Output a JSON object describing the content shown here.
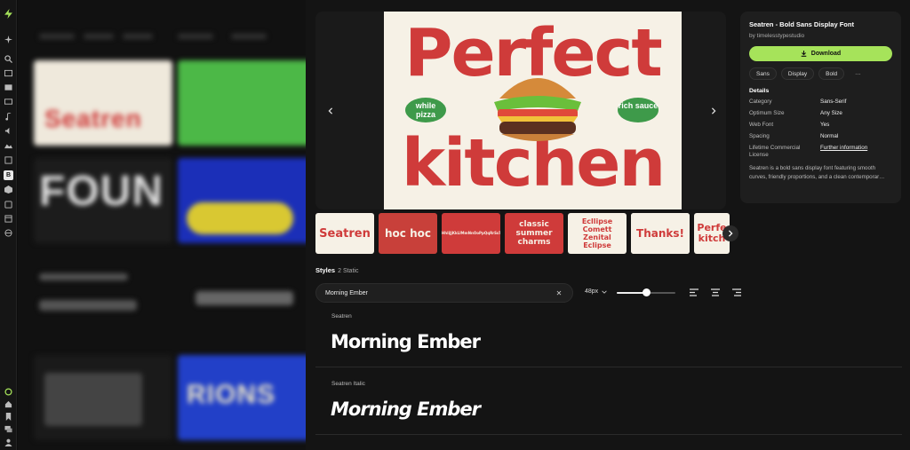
{
  "font": {
    "title": "Seatren - Bold Sans Display Font",
    "author": "by timelesstypestudio",
    "download_label": "Download",
    "tags": [
      "Sans",
      "Display",
      "Bold",
      "···"
    ],
    "details_heading": "Details",
    "details": [
      {
        "key": "Category",
        "value": "Sans-Serif"
      },
      {
        "key": "Optimum Size",
        "value": "Any Size"
      },
      {
        "key": "Web Font",
        "value": "Yes"
      },
      {
        "key": "Spacing",
        "value": "Normal"
      },
      {
        "key": "Lifetime Commercial License",
        "value": "Further information"
      }
    ],
    "description": "Seatren is a bold sans display font featuring smooth curves, friendly proportions, and a clean contemporar…"
  },
  "preview": {
    "line1": "Perfect",
    "line2": "kitchen",
    "pill_left": "while pizza",
    "pill_right": "rich sauce"
  },
  "thumbnails": [
    {
      "text": "Seatren",
      "bg": "#f6f1e6",
      "fg": "#cf3b3a"
    },
    {
      "text": "hoc hoc",
      "bg": "#c8403a",
      "fg": "#f6f1e6"
    },
    {
      "text": "AaBbCcDdEeFfGgHhIiJjKkLlMmNnOoPpQqRrSsTtUuVvWwXxYyZz",
      "bg": "#cf3b3a",
      "fg": "#f6f1e6"
    },
    {
      "text": "classic summer charms",
      "bg": "#cf3b3a",
      "fg": "#f6f1e6"
    },
    {
      "text": "Ecllipse Comett Zenital Eclipse",
      "bg": "#f6f1e6",
      "fg": "#cf3b3a"
    },
    {
      "text": "",
      "bg": "#f6f1e6",
      "fg": "#cf3b3a"
    },
    {
      "text": "Thanks!",
      "bg": "#f6f1e6",
      "fg": "#cf3b3a"
    },
    {
      "text": "Perfe kitch",
      "bg": "#f6f1e6",
      "fg": "#cf3b3a"
    }
  ],
  "styles": {
    "heading": "Styles",
    "count": "2 Static",
    "search_value": "Morning Ember",
    "size_label": "48px",
    "size_level": 0.5,
    "rows": [
      {
        "name": "Seatren",
        "sample": "Morning Ember"
      },
      {
        "name": "Seatren Italic",
        "sample": "Morning Ember"
      }
    ]
  },
  "background_tiles": [
    {
      "text": "Seatren"
    },
    {
      "text": "FOUN"
    },
    {
      "text": "RIONS"
    }
  ],
  "colors": {
    "accent": "#a6e35a",
    "poster_red": "#cf3b3a",
    "poster_cream": "#f6f1e6",
    "pill_green": "#3e9a4a"
  }
}
